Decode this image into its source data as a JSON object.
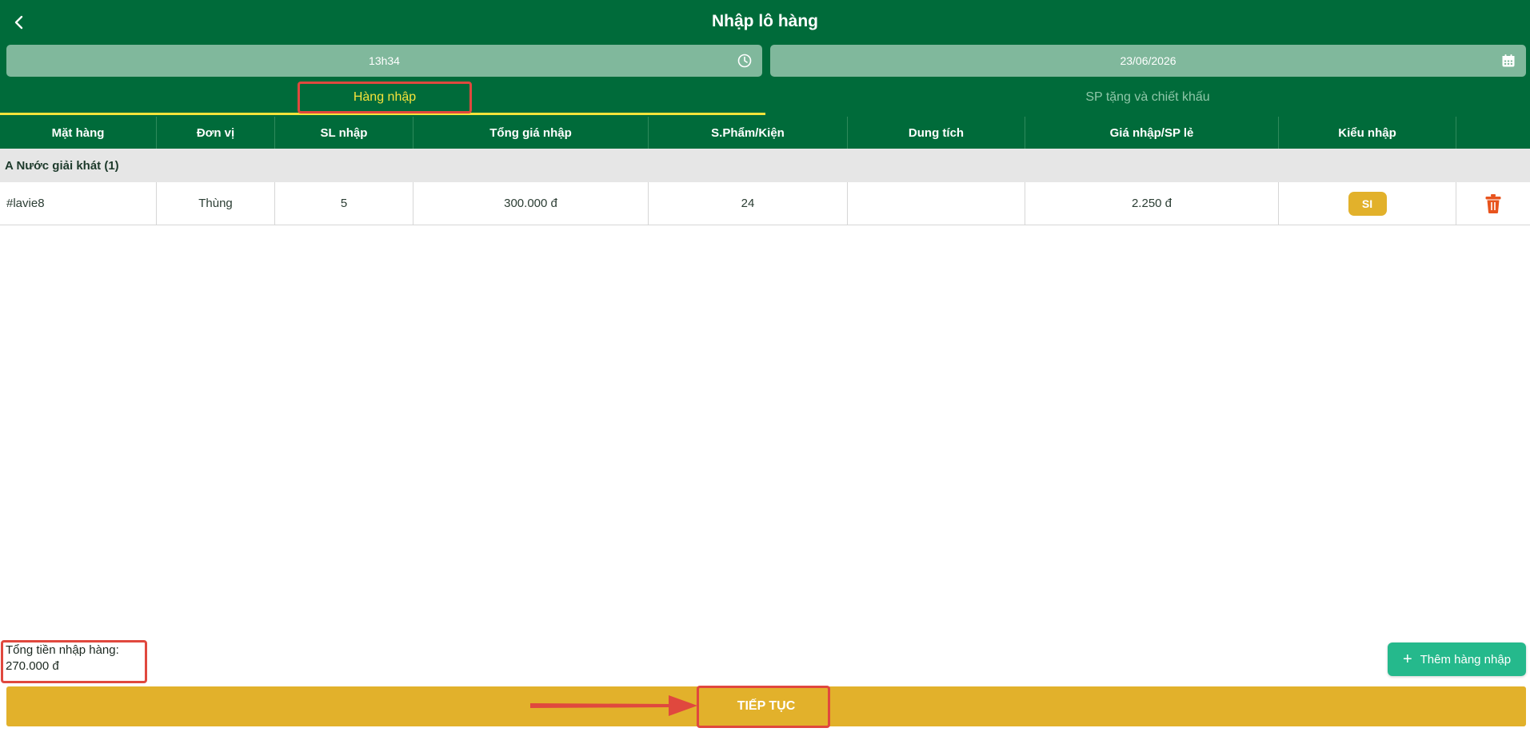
{
  "header": {
    "title": "Nhập lô hàng",
    "time_value": "13h34",
    "date_value": "23/06/2026"
  },
  "tabs": [
    {
      "label": "Hàng nhập",
      "active": true
    },
    {
      "label": "SP tặng và chiết khấu",
      "active": false
    }
  ],
  "table": {
    "columns": [
      "Mặt hàng",
      "Đơn vị",
      "SL nhập",
      "Tổng giá nhập",
      "S.Phẩm/Kiện",
      "Dung tích",
      "Giá nhập/SP lẻ",
      "Kiểu nhập",
      ""
    ],
    "group_label": "A Nước giải khát (1)",
    "rows": [
      {
        "item": "#lavie8",
        "unit": "Thùng",
        "qty": "5",
        "total_price": "300.000 đ",
        "per_case": "24",
        "volume": "",
        "unit_price": "2.250 đ",
        "import_type": "SI"
      }
    ]
  },
  "footer": {
    "total_label": "Tổng tiền nhập hàng:",
    "total_value": "270.000 đ",
    "add_button_label": "Thêm hàng nhập",
    "continue_label": "TIẾP TỤC"
  },
  "colors": {
    "primary": "#006b3a",
    "accent_yellow": "#e2b12b",
    "tab_active": "#f6e33a",
    "add_button": "#25b98c",
    "delete_icon": "#e8541e",
    "annotation": "#e0483e"
  },
  "icons": {
    "back": "chevron-left-icon",
    "time": "clock-icon",
    "date": "calendar-icon",
    "delete": "trash-icon",
    "add": "plus-icon"
  }
}
